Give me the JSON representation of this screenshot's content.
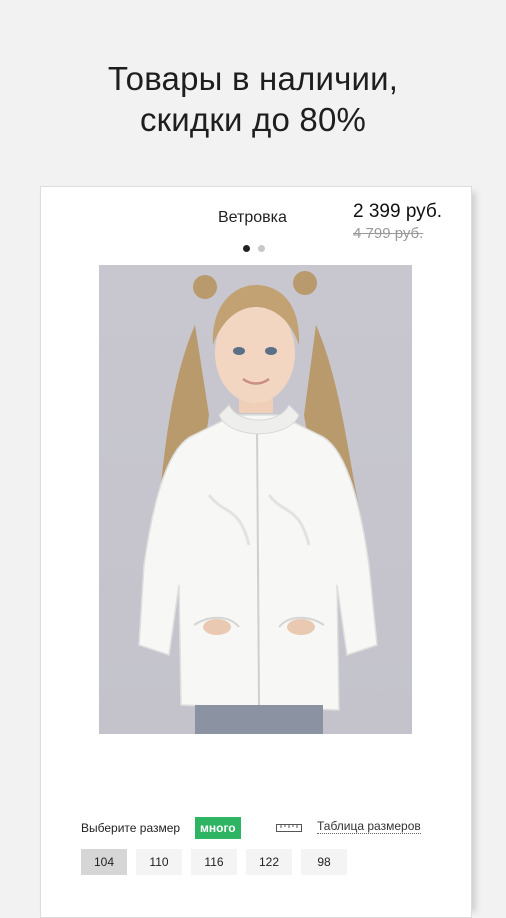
{
  "headline": {
    "line1": "Товары в наличии,",
    "line2": "скидки до 80%"
  },
  "product": {
    "title": "Ветровка",
    "price": "2 399 руб.",
    "old_price": "4 799 руб.",
    "carousel": {
      "count": 2,
      "active_index": 0
    },
    "image_alt_icon": "product-photo"
  },
  "size_selector": {
    "label": "Выберите размер",
    "stock_badge": "много",
    "size_chart_link": "Таблица размеров",
    "sizes": [
      "104",
      "110",
      "116",
      "122",
      "98"
    ],
    "selected_size": "104"
  },
  "colors": {
    "badge_bg": "#2eb463",
    "page_bg": "#f2f2f2"
  }
}
